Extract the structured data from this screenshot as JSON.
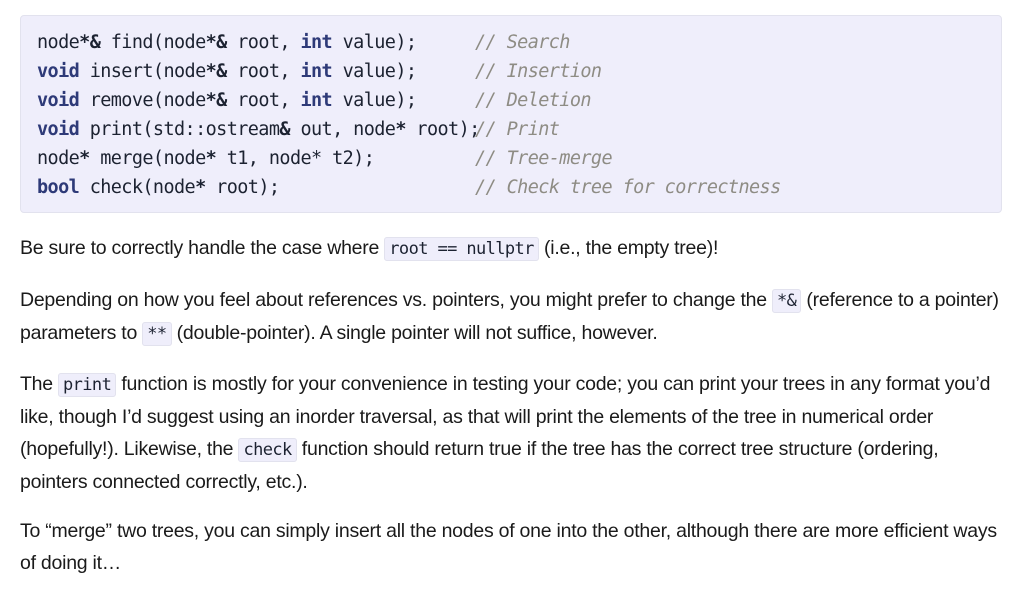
{
  "code": {
    "lines": [
      {
        "kw": "",
        "pre": "node",
        "op": "*&",
        "rest_a": " find(node",
        "op2": "*&",
        "rest_b": " root, ",
        "kw2": "int",
        "rest_c": " value);",
        "comment": "// Search"
      },
      {
        "kw": "void",
        "pre": " insert(node",
        "op": "*&",
        "rest_a": " root, ",
        "op2": "",
        "rest_b": "",
        "kw2": "int",
        "rest_c": " value);",
        "comment": "// Insertion"
      },
      {
        "kw": "void",
        "pre": " remove(node",
        "op": "*&",
        "rest_a": " root, ",
        "op2": "",
        "rest_b": "",
        "kw2": "int",
        "rest_c": " value);",
        "comment": "// Deletion"
      },
      {
        "kw": "void",
        "pre": " print(std::ostream",
        "op": "&",
        "rest_a": " out, node",
        "op2": "*",
        "rest_b": " root);",
        "kw2": "",
        "rest_c": "",
        "comment": "// Print"
      },
      {
        "kw": "",
        "pre": "node",
        "op": "*",
        "rest_a": " merge(node",
        "op2": "*",
        "rest_b": " t1, node* t2);",
        "kw2": "",
        "rest_c": "",
        "comment": "// Tree-merge"
      },
      {
        "kw": "bool",
        "pre": " check(node",
        "op": "*",
        "rest_a": " root);",
        "op2": "",
        "rest_b": "",
        "kw2": "",
        "rest_c": "",
        "comment": "// Check tree for correctness"
      }
    ]
  },
  "paragraphs": {
    "p1": {
      "a": "Be sure to correctly handle the case where ",
      "code1": "root == nullptr",
      "b": " (i.e., the empty tree)!"
    },
    "p2": {
      "a": "Depending on how you feel about references vs. pointers, you might prefer to change the ",
      "code1": "*&",
      "b": " (reference to a pointer) parameters to ",
      "code2": "**",
      "c": " (double-pointer). A single pointer will not suffice, however."
    },
    "p3": {
      "a": "The ",
      "code1": "print",
      "b": " function is mostly for your convenience in testing your code; you can print your trees in any format you’d like, though I’d suggest using an inorder traversal, as that will print the elements of the tree in numerical order (hopefully!). Likewise, the ",
      "code2": "check",
      "c": " function should return true if the tree has the correct tree structure (ordering, pointers connected correctly, etc.)."
    },
    "p4": {
      "a": "To “merge” two trees, you can simply insert all the nodes of one into the other, although there are more efficient ways of doing it…"
    }
  }
}
